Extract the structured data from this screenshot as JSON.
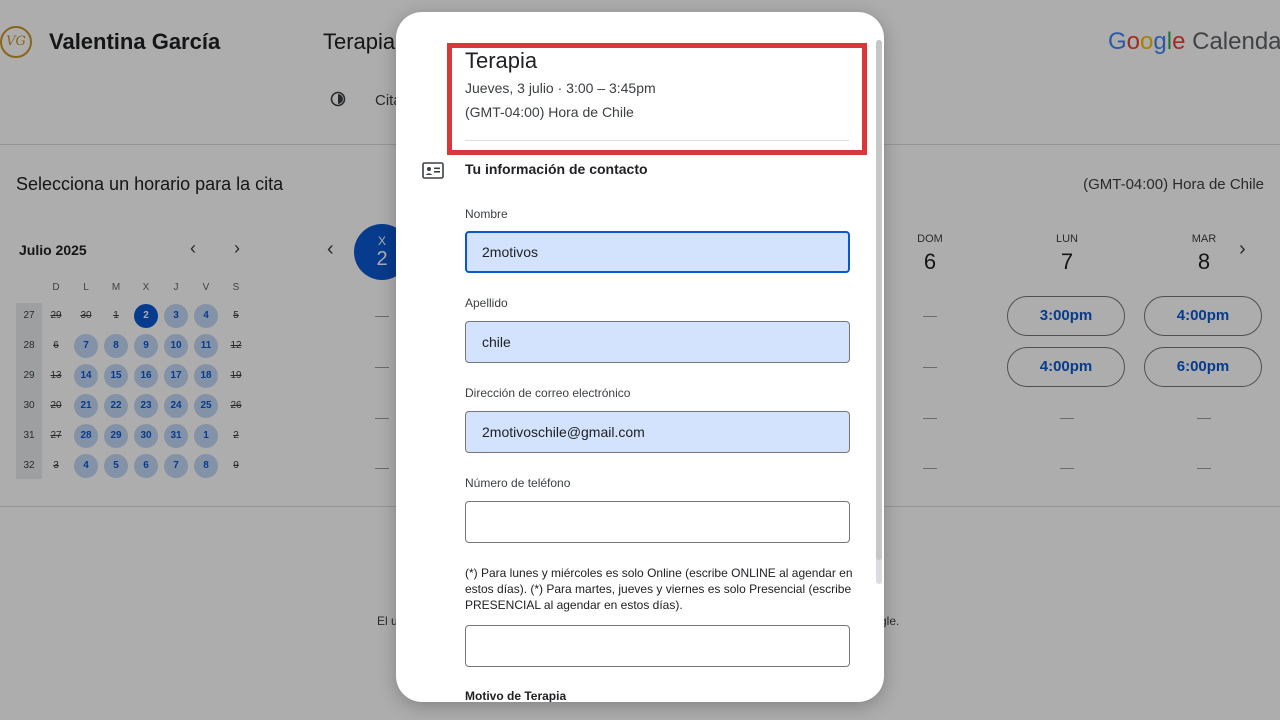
{
  "header": {
    "logo_text": "VG",
    "owner_name": "Valentina García",
    "event_title": "Terapia",
    "appointment_type": "Cita",
    "brand": {
      "letters": [
        "G",
        "o",
        "o",
        "g",
        "l",
        "e"
      ],
      "product": "Calendar"
    }
  },
  "scheduler": {
    "title": "Selecciona un horario para la cita",
    "timezone": "(GMT-04:00) Hora de Chile",
    "mini_calendar": {
      "month": "Julio 2025",
      "prev": "‹",
      "next": "›",
      "weekday_headers": [
        "D",
        "L",
        "M",
        "X",
        "J",
        "V",
        "S"
      ],
      "weeks": [
        {
          "number": "27",
          "days": [
            "29",
            "30",
            "1",
            "2",
            "3",
            "4",
            "5"
          ]
        },
        {
          "number": "28",
          "days": [
            "6",
            "7",
            "8",
            "9",
            "10",
            "11",
            "12"
          ]
        },
        {
          "number": "29",
          "days": [
            "13",
            "14",
            "15",
            "16",
            "17",
            "18",
            "19"
          ]
        },
        {
          "number": "30",
          "days": [
            "20",
            "21",
            "22",
            "23",
            "24",
            "25",
            "26"
          ]
        },
        {
          "number": "31",
          "days": [
            "27",
            "28",
            "29",
            "30",
            "31",
            "1",
            "2"
          ]
        },
        {
          "number": "32",
          "days": [
            "3",
            "4",
            "5",
            "6",
            "7",
            "8",
            "9"
          ]
        }
      ]
    },
    "selected_day": {
      "name": "X",
      "date": "2"
    },
    "visible_days": [
      {
        "name": "DOM",
        "date": "6"
      },
      {
        "name": "LUN",
        "date": "7"
      },
      {
        "name": "MAR",
        "date": "8"
      }
    ],
    "slots": {
      "lun": [
        "3:00pm",
        "4:00pm"
      ],
      "mar": [
        "4:00pm",
        "6:00pm"
      ]
    },
    "nav_prev": "‹",
    "nav_next": "›",
    "footer_left": "El u",
    "footer_right": "gle."
  },
  "dialog": {
    "title": "Terapia",
    "datetime": "Jueves, 3 julio · 3:00 – 3:45pm",
    "timezone": "(GMT-04:00) Hora de Chile",
    "contact_section": "Tu información de contacto",
    "fields": {
      "first_name": {
        "label": "Nombre",
        "value": "2motivos"
      },
      "last_name": {
        "label": "Apellido",
        "value": "chile"
      },
      "email": {
        "label": "Dirección de correo electrónico",
        "value": "2motivoschile@gmail.com"
      },
      "phone": {
        "label": "Número de teléfono",
        "value": ""
      },
      "modality": {
        "help": "(*) Para lunes y miércoles es solo Online (escribe ONLINE al agendar en estos días). (*) Para martes, jueves y viernes es solo Presencial (escribe PRESENCIAL al agendar en estos días).",
        "value": ""
      },
      "reason": {
        "label": "Motivo de Terapia"
      }
    }
  },
  "colors": {
    "accent": "#0b57d0",
    "highlight_box": "#d93838",
    "filled_input": "#d3e3fd"
  }
}
